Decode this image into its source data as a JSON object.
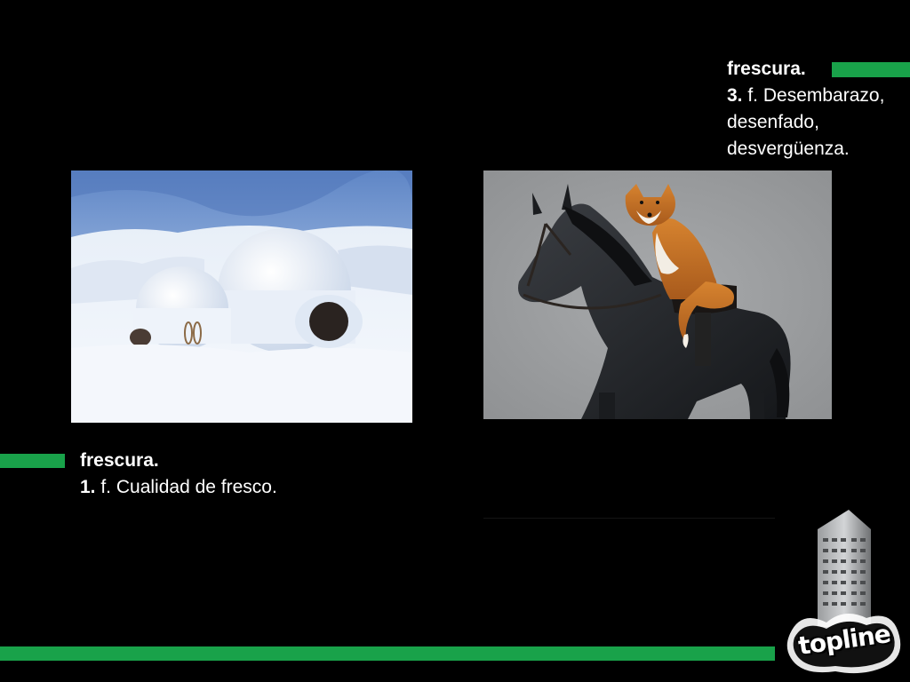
{
  "slide": {
    "definition_right": {
      "term": "frescura.",
      "number": "3.",
      "text_line1": " f. Desembarazo,",
      "text_line2": "desenfado,",
      "text_line3": "desvergüenza."
    },
    "definition_left": {
      "term": "frescura.",
      "number": "1.",
      "text": " f. Cualidad de fresco."
    },
    "images": {
      "left": "igloo-photo",
      "right": "fox-riding-horse-photo"
    },
    "logo": {
      "text": "topline"
    },
    "colors": {
      "accent": "#19a24a",
      "background": "#000000",
      "text": "#ffffff"
    }
  }
}
